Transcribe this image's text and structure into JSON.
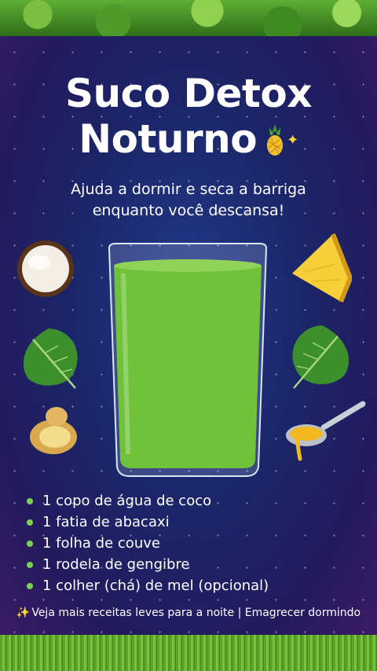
{
  "title": {
    "line1": "Suco Detox",
    "line2": "Noturno"
  },
  "title_icons": [
    "pineapple-icon",
    "sparkle-icon"
  ],
  "subtitle": {
    "line1": "Ajuda a dormir e seca a barriga",
    "line2": "enquanto você descansa!"
  },
  "ingredient_images": [
    "coconut",
    "pineapple",
    "kale-leaf",
    "kale-leaf",
    "ginger",
    "honey-spoon",
    "green-juice-glass"
  ],
  "ingredients": [
    "1 copo de água de coco",
    "1 fatia de abacaxi",
    "1 folha de couve",
    "1 rodela de gengibre",
    "1 colher (chá) de mel (opcional)"
  ],
  "footer": {
    "text": "Veja mais receitas leves para a noite | Emagrecer dormindo"
  },
  "colors": {
    "background": "#1b2568",
    "bullet": "#7bd14f",
    "juice": "#6fc23a",
    "text": "#ffffff"
  }
}
